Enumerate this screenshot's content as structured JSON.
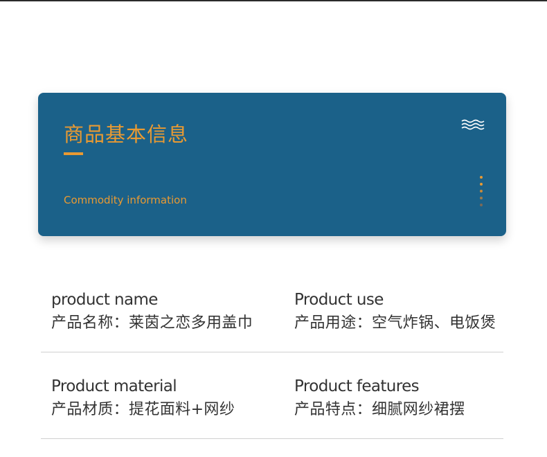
{
  "banner": {
    "title": "商品基本信息",
    "subtitle": "Commodity information",
    "accent_color": "#e99a32",
    "background_color": "#1b6189",
    "icons": [
      "wave-icon",
      "vertical-dots-icon"
    ]
  },
  "info": {
    "rows": [
      {
        "left": {
          "label": "product name",
          "value": "产品名称：莱茵之恋多用盖巾"
        },
        "right": {
          "label": "Product use",
          "value": "产品用途：空气炸锅、电饭煲"
        }
      },
      {
        "left": {
          "label": "Product material",
          "value": "产品材质：提花面料+网纱"
        },
        "right": {
          "label": "Product features",
          "value": "产品特点：细腻网纱裙摆"
        }
      }
    ]
  }
}
